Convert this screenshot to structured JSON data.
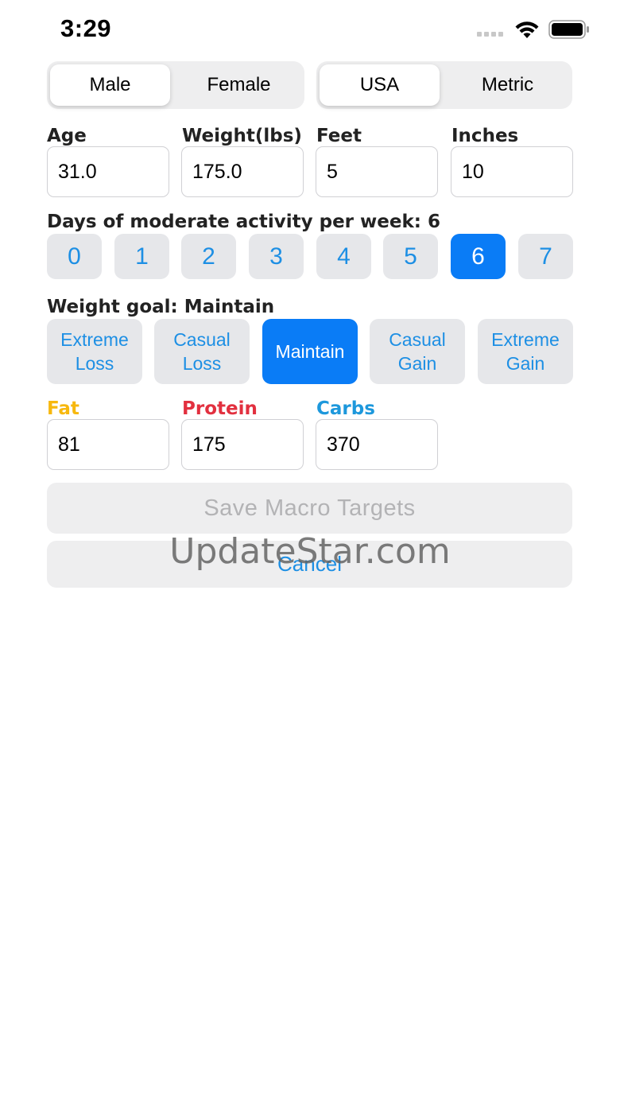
{
  "status_bar": {
    "time": "3:29",
    "signal_icon": "cellular-signal-icon",
    "wifi_icon": "wifi-icon",
    "battery_icon": "battery-icon"
  },
  "sex_toggle": {
    "options": [
      "Male",
      "Female"
    ],
    "selected": "Male"
  },
  "unit_toggle": {
    "options": [
      "USA",
      "Metric"
    ],
    "selected": "USA"
  },
  "fields": {
    "age_label": "Age",
    "age_value": "31.0",
    "weight_label": "Weight(lbs)",
    "weight_value": "175.0",
    "feet_label": "Feet",
    "feet_value": "5",
    "inches_label": "Inches",
    "inches_value": "10"
  },
  "activity": {
    "label": "Days of moderate activity per week: 6",
    "options": [
      "0",
      "1",
      "2",
      "3",
      "4",
      "5",
      "6",
      "7"
    ],
    "selected": "6"
  },
  "goal": {
    "label": "Weight goal: Maintain",
    "options": [
      "Extreme Loss",
      "Casual Loss",
      "Maintain",
      "Casual Gain",
      "Extreme Gain"
    ],
    "selected": "Maintain"
  },
  "macros": {
    "fat_label": "Fat",
    "fat_value": "81",
    "fat_color": "#f7b80e",
    "protein_label": "Protein",
    "protein_value": "175",
    "protein_color": "#e2303f",
    "carbs_label": "Carbs",
    "carbs_value": "370",
    "carbs_color": "#1d98dc"
  },
  "actions": {
    "save_label": "Save Macro Targets",
    "cancel_label": "Cancel"
  },
  "watermark": "UpdateStar.com",
  "colors": {
    "accent": "#0a7cf6",
    "button_bg": "#e6e7ea",
    "button_text": "#1d8fe4"
  }
}
